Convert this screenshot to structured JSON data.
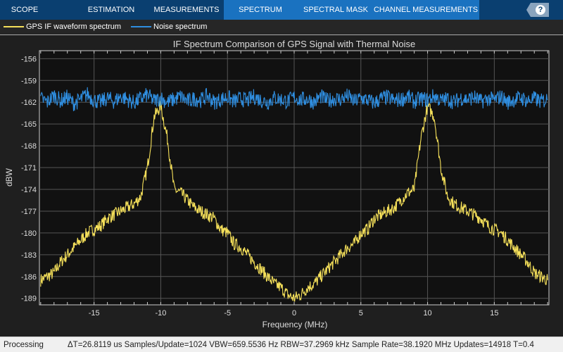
{
  "toolbar": {
    "tabs": [
      {
        "label": "SCOPE",
        "center": 35
      },
      {
        "label": "ESTIMATION",
        "center": 158
      },
      {
        "label": "MEASUREMENTS",
        "center": 265
      },
      {
        "label": "SPECTRUM",
        "center": 370
      },
      {
        "label": "SPECTRAL MASK",
        "center": 477
      },
      {
        "label": "CHANNEL MEASUREMENTS",
        "center": 605
      }
    ],
    "active_tab": "SPECTRUM",
    "help_label": "?"
  },
  "legend": [
    {
      "name": "GPS IF waveform spectrum",
      "color": "#f5e05a"
    },
    {
      "name": "Noise spectrum",
      "color": "#2f8ee0"
    }
  ],
  "chart_data": {
    "type": "line",
    "title": "IF Spectrum Comparison of GPS Signal with Thermal Noise",
    "xlabel": "Frequency (MHz)",
    "ylabel": "dBW",
    "xlim": [
      -19.096,
      19.096
    ],
    "ylim": [
      -189.9,
      -154.9
    ],
    "xticks": [
      -15,
      -10,
      -5,
      0,
      5,
      10,
      15
    ],
    "yticks": [
      -156,
      -159,
      -162,
      -165,
      -168,
      -171,
      -174,
      -177,
      -180,
      -183,
      -186,
      -189
    ],
    "grid": true,
    "x": [
      -19,
      -18.5,
      -18,
      -17.5,
      -17,
      -16.5,
      -16,
      -15.5,
      -15,
      -14.5,
      -14,
      -13.5,
      -13,
      -12.5,
      -12,
      -11.5,
      -11,
      -10.5,
      -10,
      -9.5,
      -9,
      -8.5,
      -8,
      -7.5,
      -7,
      -6.5,
      -6,
      -5.5,
      -5,
      -4.5,
      -4,
      -3.5,
      -3,
      -2.5,
      -2,
      -1.5,
      -1,
      -0.5,
      0,
      0.5,
      1,
      1.5,
      2,
      2.5,
      3,
      3.5,
      4,
      4.5,
      5,
      5.5,
      6,
      6.5,
      7,
      7.5,
      8,
      8.5,
      9,
      9.5,
      10,
      10.5,
      11,
      11.5,
      12,
      12.5,
      13,
      13.5,
      14,
      14.5,
      15,
      15.5,
      16,
      16.5,
      17,
      17.5,
      18,
      18.5,
      19
    ],
    "series": [
      {
        "name": "GPS IF waveform spectrum",
        "color": "#f5e05a",
        "values": [
          -186.5,
          -186,
          -185.5,
          -184,
          -183,
          -182,
          -181,
          -180,
          -179.5,
          -179,
          -178,
          -177.5,
          -177,
          -176.5,
          -176,
          -175,
          -171,
          -164,
          -162.5,
          -167,
          -174,
          -174.5,
          -175.5,
          -176.5,
          -177,
          -177.5,
          -178,
          -179.5,
          -180,
          -181.5,
          -182,
          -183,
          -184,
          -185,
          -186,
          -187,
          -187.5,
          -188.5,
          -189,
          -188.5,
          -187.5,
          -187,
          -186,
          -185,
          -184,
          -183,
          -182,
          -181.5,
          -180,
          -179.5,
          -178,
          -177.5,
          -177,
          -176.5,
          -175.5,
          -174.5,
          -174,
          -167,
          -162.5,
          -164,
          -171,
          -175,
          -176,
          -176.5,
          -177,
          -177.5,
          -178,
          -179,
          -179.5,
          -180,
          -181,
          -182,
          -183,
          -184,
          -185.5,
          -186,
          -186.5
        ]
      },
      {
        "name": "Noise spectrum",
        "color": "#2f8ee0",
        "values": [
          -161.5,
          -162,
          -161,
          -161.8,
          -161.3,
          -162.2,
          -161.6,
          -160.9,
          -161.7,
          -162,
          -161.4,
          -161.9,
          -161.2,
          -161.6,
          -162.1,
          -161.5,
          -161,
          -161.8,
          -161.4,
          -162,
          -161.6,
          -161.2,
          -161.9,
          -161.5,
          -161.7,
          -161.1,
          -162,
          -161.6,
          -161.3,
          -161.9,
          -161.5,
          -161.8,
          -161.2,
          -161.7,
          -162,
          -161.4,
          -161.6,
          -161.9,
          -161.3,
          -161.7,
          -161.5,
          -162,
          -161.2,
          -161.8,
          -161.5,
          -161.6,
          -161.1,
          -161.9,
          -161.4,
          -161.7,
          -162.1,
          -161.5,
          -161.3,
          -161.8,
          -161.6,
          -161.2,
          -161.9,
          -161.5,
          -161.7,
          -161.1,
          -161.8,
          -161.5,
          -162,
          -161.4,
          -161.6,
          -161.3,
          -161.9,
          -161.5,
          -161.7,
          -161.2,
          -162,
          -161.6,
          -161.4,
          -161.8,
          -161.5,
          -161.9,
          -161.6
        ]
      }
    ]
  },
  "status": {
    "state": "Processing",
    "readouts": "ΔT=26.8119 us  Samples/Update=1024  VBW=659.5536 Hz  RBW=37.2969 kHz  Sample Rate=38.1920 MHz  Updates=14918  T=0.4"
  }
}
